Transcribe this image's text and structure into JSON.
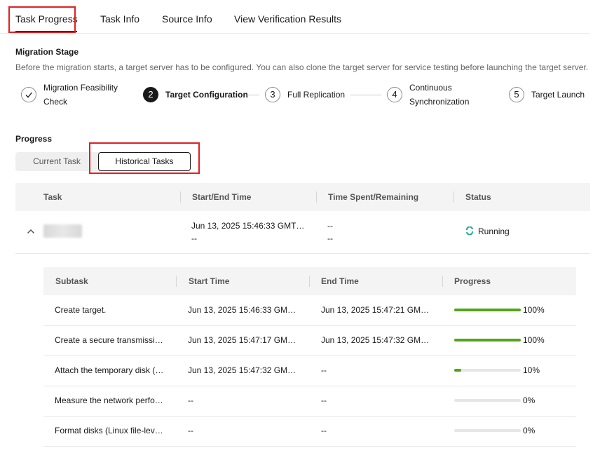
{
  "tabs": [
    {
      "label": "Task Progress",
      "active": true
    },
    {
      "label": "Task Info",
      "active": false
    },
    {
      "label": "Source Info",
      "active": false
    },
    {
      "label": "View Verification Results",
      "active": false
    }
  ],
  "migration_stage": {
    "title": "Migration Stage",
    "description": "Before the migration starts, a target server has to be configured. You can also clone the target server for service testing before launching the target server.",
    "steps": [
      {
        "number": "",
        "label_line1": "Migration Feasibility",
        "label_line2": "Check",
        "state": "done"
      },
      {
        "number": "2",
        "label_line1": "Target Configuration",
        "label_line2": "",
        "state": "active"
      },
      {
        "number": "3",
        "label_line1": "Full Replication",
        "label_line2": "",
        "state": "pending"
      },
      {
        "number": "4",
        "label_line1": "Continuous",
        "label_line2": "Synchronization",
        "state": "pending"
      },
      {
        "number": "5",
        "label_line1": "Target Launch",
        "label_line2": "",
        "state": "pending"
      }
    ]
  },
  "progress": {
    "title": "Progress",
    "segments": [
      {
        "label": "Current Task",
        "active": false
      },
      {
        "label": "Historical Tasks",
        "active": true
      }
    ],
    "columns": [
      "Task",
      "Start/End Time",
      "Time Spent/Remaining",
      "Status"
    ],
    "row": {
      "start": "Jun 13, 2025 15:46:33 GMT…",
      "end": "--",
      "spent": "--",
      "remaining": "--",
      "status": "Running",
      "status_color": "#1aaf8b"
    },
    "subtask_columns": [
      "Subtask",
      "Start Time",
      "End Time",
      "Progress"
    ],
    "subtasks": [
      {
        "name": "Create target.",
        "start": "Jun 13, 2025 15:46:33 GM…",
        "end": "Jun 13, 2025 15:47:21 GM…",
        "progress": 100,
        "progress_label": "100%"
      },
      {
        "name": "Create a secure transmissi…",
        "start": "Jun 13, 2025 15:47:17 GM…",
        "end": "Jun 13, 2025 15:47:32 GM…",
        "progress": 100,
        "progress_label": "100%"
      },
      {
        "name": "Attach the temporary disk (…",
        "start": "Jun 13, 2025 15:47:32 GM…",
        "end": "--",
        "progress": 10,
        "progress_label": "10%"
      },
      {
        "name": "Measure the network perfo…",
        "start": "--",
        "end": "--",
        "progress": 0,
        "progress_label": "0%"
      },
      {
        "name": "Format disks (Linux file-lev…",
        "start": "--",
        "end": "--",
        "progress": 0,
        "progress_label": "0%"
      }
    ]
  },
  "colors": {
    "highlight_box": "#e02020",
    "progress_fill": "#52a41a",
    "progress_track": "#e6e6e6"
  }
}
